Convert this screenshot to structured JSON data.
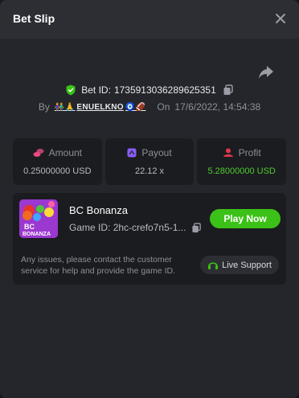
{
  "dialog": {
    "title": "Bet Slip"
  },
  "bet": {
    "id_label": "Bet ID:",
    "id_value": "173591303628962535​1",
    "by_label": "By",
    "username": "ENUELKNO",
    "user_emojis_left": "👫🙏",
    "user_emojis_right": "🧿🏈",
    "on_label": "On",
    "date": "17/6/2022, 14:54:38"
  },
  "stats": [
    {
      "label": "Amount",
      "value": "0.25000000 USD",
      "icon": "coins-icon",
      "color": "#e84a7f"
    },
    {
      "label": "Payout",
      "value": "22.12 x",
      "icon": "payout-icon",
      "color": "#8a5cf6"
    },
    {
      "label": "Profit",
      "value": "5.28000000 USD",
      "icon": "profit-icon",
      "color": "#e0374b"
    }
  ],
  "game": {
    "name": "BC Bonanza",
    "id_label": "Game ID:",
    "id_value": "2hc-crefo7n5-1...",
    "play_label": "Play Now",
    "thumb_text_1": "BC",
    "thumb_text_2": "BONANZA",
    "issue_text": "Any issues, please contact the customer service for help and provide the game ID.",
    "support_label": "Live Support"
  },
  "colors": {
    "accent_green": "#3bc117",
    "profit_green": "#4fcc2e",
    "background": "#24262b",
    "card": "#1b1c20"
  }
}
